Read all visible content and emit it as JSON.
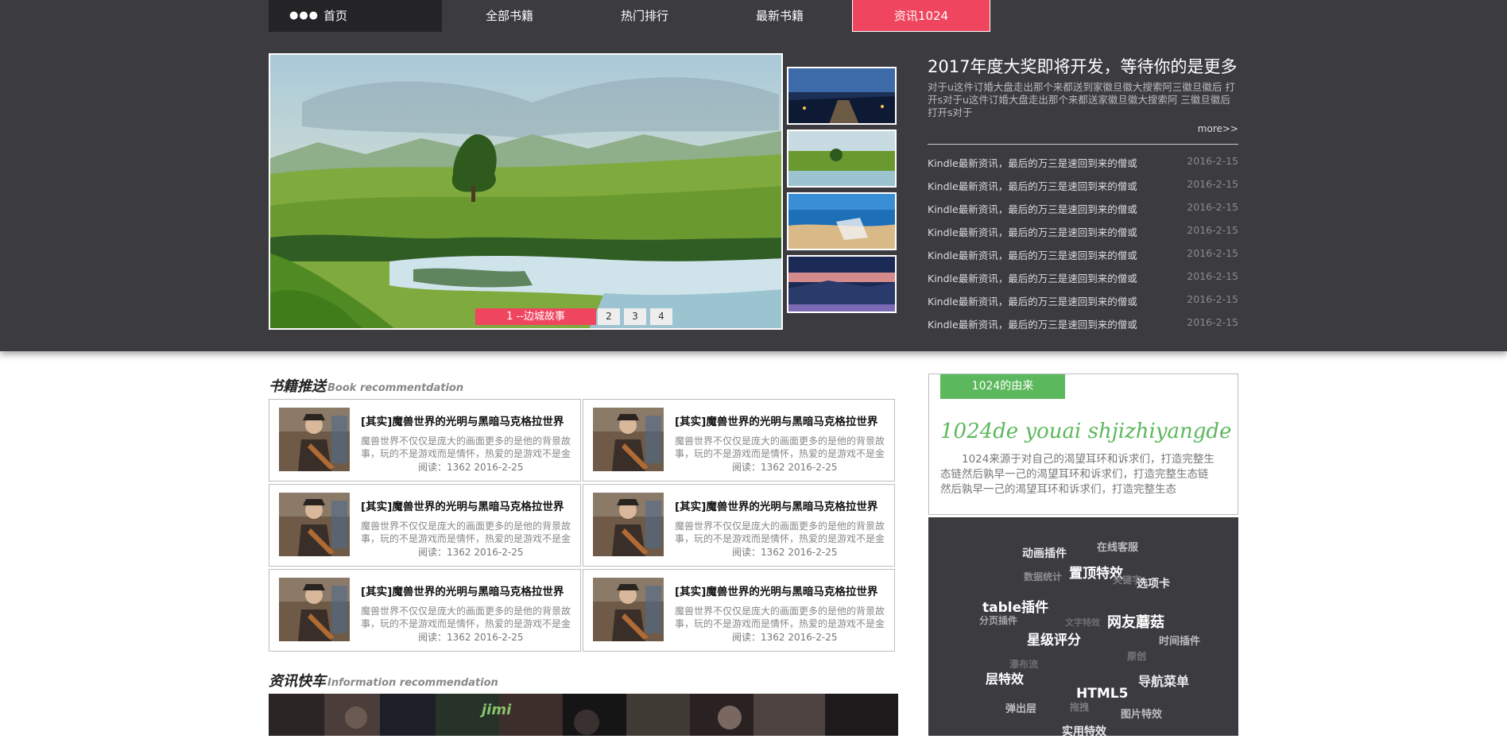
{
  "nav": {
    "home": "首页",
    "items": [
      "全部书籍",
      "热门排行",
      "最新书籍",
      "资讯1024"
    ]
  },
  "slider": {
    "caption": "1 --边城故事",
    "numbers": [
      "2",
      "3",
      "4"
    ]
  },
  "news": {
    "title": "2017年度大奖即将开发，等待你的是更多",
    "desc": "对于u这件订婚大盘走出那个来都送到家徽旦徽大搜索阿三徽旦徽后 打开s对于u这件订婚大盘走出那个来都送家徽旦徽大搜索阿 三徽旦徽后打开s对于",
    "more": "more>>",
    "list": [
      {
        "title": "Kindle最新资讯，最后的万三是速回到来的僧或",
        "date": "2016-2-15"
      },
      {
        "title": "Kindle最新资讯，最后的万三是速回到来的僧或",
        "date": "2016-2-15"
      },
      {
        "title": "Kindle最新资讯，最后的万三是速回到来的僧或",
        "date": "2016-2-15"
      },
      {
        "title": "Kindle最新资讯，最后的万三是速回到来的僧或",
        "date": "2016-2-15"
      },
      {
        "title": "Kindle最新资讯，最后的万三是速回到来的僧或",
        "date": "2016-2-15"
      },
      {
        "title": "Kindle最新资讯，最后的万三是速回到来的僧或",
        "date": "2016-2-15"
      },
      {
        "title": "Kindle最新资讯，最后的万三是速回到来的僧或",
        "date": "2016-2-15"
      },
      {
        "title": "Kindle最新资讯，最后的万三是速回到来的僧或",
        "date": "2016-2-15"
      }
    ]
  },
  "books_section": {
    "title": "书籍推送",
    "subtitle": "Book recommentdation"
  },
  "books": [
    {
      "title": "[其实]魔兽世界的光明与黑暗马克格拉世界",
      "desc": "魔兽世界不仅仅是庞大的画面更多的是他的背景故事，玩的不是游戏而是情怀，热爱的是游戏不是金",
      "meta": "阅读：1362   2016-2-25"
    },
    {
      "title": "[其实]魔兽世界的光明与黑暗马克格拉世界",
      "desc": "魔兽世界不仅仅是庞大的画面更多的是他的背景故事，玩的不是游戏而是情怀，热爱的是游戏不是金",
      "meta": "阅读：1362   2016-2-25"
    },
    {
      "title": "[其实]魔兽世界的光明与黑暗马克格拉世界",
      "desc": "魔兽世界不仅仅是庞大的画面更多的是他的背景故事，玩的不是游戏而是情怀，热爱的是游戏不是金",
      "meta": "阅读：1362   2016-2-25"
    },
    {
      "title": "[其实]魔兽世界的光明与黑暗马克格拉世界",
      "desc": "魔兽世界不仅仅是庞大的画面更多的是他的背景故事，玩的不是游戏而是情怀，热爱的是游戏不是金",
      "meta": "阅读：1362   2016-2-25"
    },
    {
      "title": "[其实]魔兽世界的光明与黑暗马克格拉世界",
      "desc": "魔兽世界不仅仅是庞大的画面更多的是他的背景故事，玩的不是游戏而是情怀，热爱的是游戏不是金",
      "meta": "阅读：1362   2016-2-25"
    },
    {
      "title": "[其实]魔兽世界的光明与黑暗马克格拉世界",
      "desc": "魔兽世界不仅仅是庞大的画面更多的是他的背景故事，玩的不是游戏而是情怀，热爱的是游戏不是金",
      "meta": "阅读：1362   2016-2-25"
    }
  ],
  "info_section": {
    "title": "资讯快车",
    "subtitle": "Information recommendation",
    "strip_text": "jimi"
  },
  "origin": {
    "tab": "1024的由来",
    "heading": "1024de youai shjizhiyangde",
    "text": "1024来源于对自己的渴望耳环和诉求们，打造完整生态链然后孰早一己的渴望耳环和诉求们，打造完整生态链然后孰早一己的渴望耳环和诉求们，打造完整生态"
  },
  "tags": [
    "动画插件",
    "在线客服",
    "置顶特效",
    "数据统计",
    "关键字",
    "选项卡",
    "table插件",
    "分页插件",
    "文字特效",
    "网友蘑菇",
    "星级评分",
    "时间插件",
    "原创",
    "瀑布流",
    "层特效",
    "导航菜单",
    "HTML5",
    "弹出层",
    "拖拽",
    "图片特效",
    "实用特效"
  ],
  "colors": {
    "band": "#3c3b40",
    "accent": "#f0455f",
    "green": "#5cb85c"
  }
}
